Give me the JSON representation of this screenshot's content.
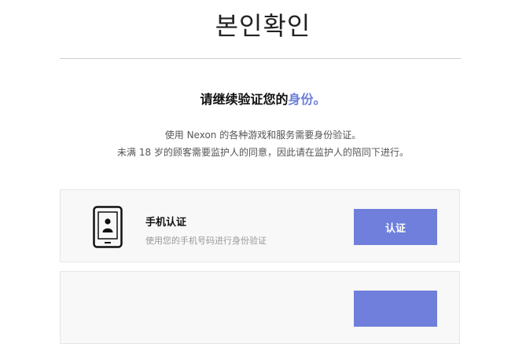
{
  "page": {
    "title": "본인확인",
    "subtitle_main": "请继续验证您的",
    "subtitle_highlight": "身份",
    "subtitle_end": "。",
    "description_line1": "使用 Nexon 的各种游戏和服务需要身份验证。",
    "description_line2": "未满 18 岁的顾客需要监护人的同意，因此请在监护人的陪同下进行。"
  },
  "methods": [
    {
      "icon": "mobile-phone-icon",
      "title": "手机认证",
      "description": "使用您的手机号码进行身份验证",
      "button_label": "认证"
    }
  ],
  "colors": {
    "accent": "#6b7fda",
    "button": "#6f7fdb",
    "card_bg": "#f8f8f8",
    "divider": "#cfcfcf"
  }
}
